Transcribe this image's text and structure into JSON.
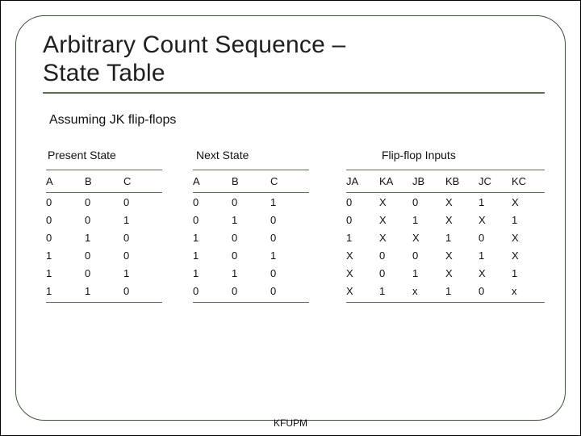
{
  "title_line1": "Arbitrary Count Sequence –",
  "title_line2": "State Table",
  "subtitle": "Assuming JK flip-flops",
  "groups": {
    "present": "Present State",
    "next": "Next State",
    "ff": "Flip-flop Inputs"
  },
  "headers": {
    "present": [
      "A",
      "B",
      "C"
    ],
    "next": [
      "A",
      "B",
      "C"
    ],
    "ff": [
      "JA",
      "KA",
      "JB",
      "KB",
      "JC",
      "KC"
    ]
  },
  "rows": [
    {
      "present": [
        "0",
        "0",
        "0"
      ],
      "next": [
        "0",
        "0",
        "1"
      ],
      "ff": [
        "0",
        "X",
        "0",
        "X",
        "1",
        "X"
      ]
    },
    {
      "present": [
        "0",
        "0",
        "1"
      ],
      "next": [
        "0",
        "1",
        "0"
      ],
      "ff": [
        "0",
        "X",
        "1",
        "X",
        "X",
        "1"
      ]
    },
    {
      "present": [
        "0",
        "1",
        "0"
      ],
      "next": [
        "1",
        "0",
        "0"
      ],
      "ff": [
        "1",
        "X",
        "X",
        "1",
        "0",
        "X"
      ]
    },
    {
      "present": [
        "1",
        "0",
        "0"
      ],
      "next": [
        "1",
        "0",
        "1"
      ],
      "ff": [
        "X",
        "0",
        "0",
        "X",
        "1",
        "X"
      ]
    },
    {
      "present": [
        "1",
        "0",
        "1"
      ],
      "next": [
        "1",
        "1",
        "0"
      ],
      "ff": [
        "X",
        "0",
        "1",
        "X",
        "X",
        "1"
      ]
    },
    {
      "present": [
        "1",
        "1",
        "0"
      ],
      "next": [
        "0",
        "0",
        "0"
      ],
      "ff": [
        "X",
        "1",
        "x",
        "1",
        "0",
        "x"
      ]
    }
  ],
  "footer": "KFUPM",
  "chart_data": {
    "type": "table",
    "title": "Arbitrary Count Sequence – State Table",
    "columns": [
      "A",
      "B",
      "C",
      "A(next)",
      "B(next)",
      "C(next)",
      "JA",
      "KA",
      "JB",
      "KB",
      "JC",
      "KC"
    ],
    "rows": [
      [
        "0",
        "0",
        "0",
        "0",
        "0",
        "1",
        "0",
        "X",
        "0",
        "X",
        "1",
        "X"
      ],
      [
        "0",
        "0",
        "1",
        "0",
        "1",
        "0",
        "0",
        "X",
        "1",
        "X",
        "X",
        "1"
      ],
      [
        "0",
        "1",
        "0",
        "1",
        "0",
        "0",
        "1",
        "X",
        "X",
        "1",
        "0",
        "X"
      ],
      [
        "1",
        "0",
        "0",
        "1",
        "0",
        "1",
        "X",
        "0",
        "0",
        "X",
        "1",
        "X"
      ],
      [
        "1",
        "0",
        "1",
        "1",
        "1",
        "0",
        "X",
        "0",
        "1",
        "X",
        "X",
        "1"
      ],
      [
        "1",
        "1",
        "0",
        "0",
        "0",
        "0",
        "X",
        "1",
        "x",
        "1",
        "0",
        "x"
      ]
    ]
  }
}
